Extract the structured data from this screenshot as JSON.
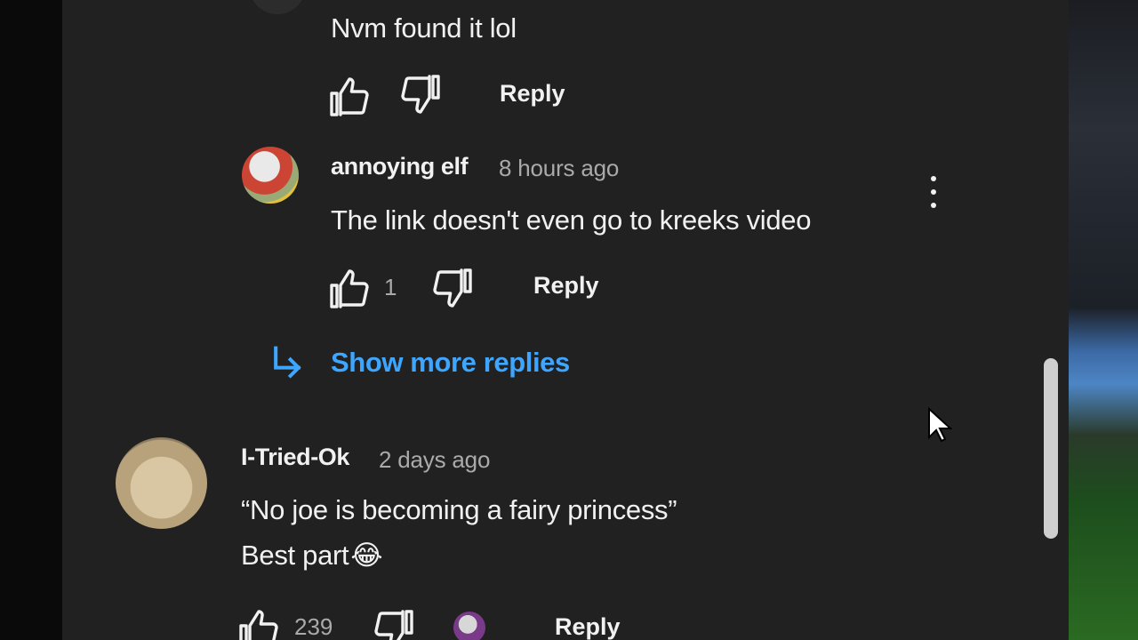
{
  "comments": {
    "reply1": {
      "text": "Nvm found it lol",
      "reply_label": "Reply"
    },
    "reply2": {
      "author": "annoying elf",
      "time": "8 hours ago",
      "text": "The link doesn't even go to kreeks video",
      "likes": "1",
      "reply_label": "Reply"
    },
    "show_more": "Show more replies",
    "comment3": {
      "author": "I-Tried-Ok",
      "time": "2 days ago",
      "text_line1": "“No joe is becoming a fairy princess”",
      "text_line2": "Best part",
      "emoji": "😂",
      "likes": "239",
      "reply_label": "Reply"
    }
  },
  "icons": {
    "like": "thumbs-up-icon",
    "dislike": "thumbs-down-icon",
    "more": "more-vertical-icon",
    "show_more_arrow": "reply-arrow-icon",
    "cursor": "mouse-cursor-icon"
  },
  "colors": {
    "panel_bg": "#212121",
    "link_blue": "#3ea6ff",
    "secondary_text": "#aaaaaa"
  }
}
